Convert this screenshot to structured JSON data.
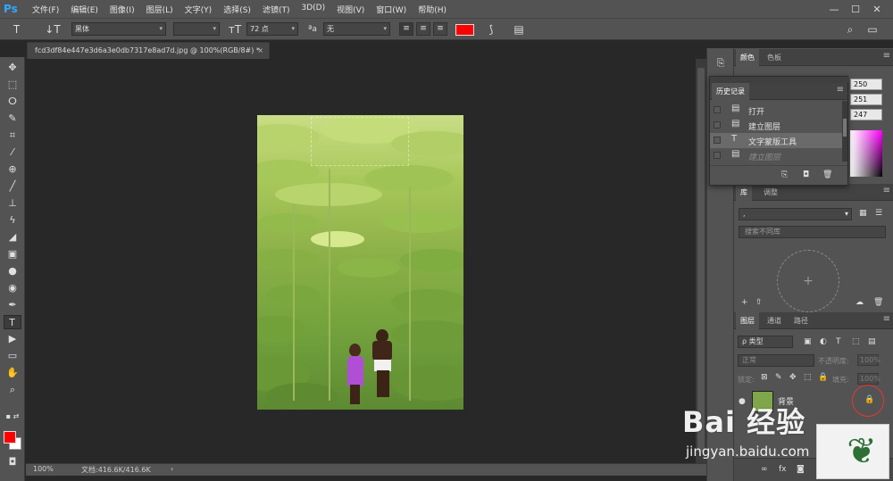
{
  "app": {
    "logo": "Ps",
    "menu": [
      "文件(F)",
      "编辑(E)",
      "图像(I)",
      "图层(L)",
      "文字(Y)",
      "选择(S)",
      "滤镜(T)",
      "3D(D)",
      "视图(V)",
      "窗口(W)",
      "帮助(H)"
    ],
    "window_controls": [
      "—",
      "☐",
      "✕"
    ]
  },
  "options_bar": {
    "font_family": "黑体",
    "font_style": "",
    "font_size": "72 点",
    "aa_label": "ªa",
    "antialias": "无",
    "text_color": "#ff0000"
  },
  "document": {
    "tab_title": "fcd3df84e447e3d6a3e0db7317e8ad7d.jpg @ 100%(RGB/8#) *",
    "close": "×",
    "zoom": "100%",
    "doc_info": "文档:416.6K/416.6K"
  },
  "tools": {
    "foreground": "#ff0000",
    "background": "#ffffff"
  },
  "color_panel": {
    "tabs": [
      "颜色",
      "色板"
    ],
    "r": "250",
    "g": "251",
    "b": "247"
  },
  "history_panel": {
    "title": "历史记录",
    "items": [
      {
        "label": "打开",
        "icon": "document-icon"
      },
      {
        "label": "建立图层",
        "icon": "document-icon"
      },
      {
        "label": "文字蒙版工具",
        "icon": "type-icon"
      },
      {
        "label": "建立图层",
        "icon": "document-icon"
      }
    ]
  },
  "library_panel": {
    "tabs": [
      "库",
      "调整"
    ],
    "library_select": ",",
    "search_placeholder": "搜索不同库"
  },
  "layers_panel": {
    "tabs": [
      "图层",
      "通道",
      "路径"
    ],
    "filter_label": "ρ 类型",
    "blend_mode": "正常",
    "opacity_label": "不透明度:",
    "opacity_value": "100%",
    "lock_label": "锁定:",
    "fill_label": "填充:",
    "fill_value": "100%",
    "layer_name": "背景"
  },
  "watermark": {
    "brand": "Bai 经验",
    "url": "jingyan.baidu.com"
  }
}
